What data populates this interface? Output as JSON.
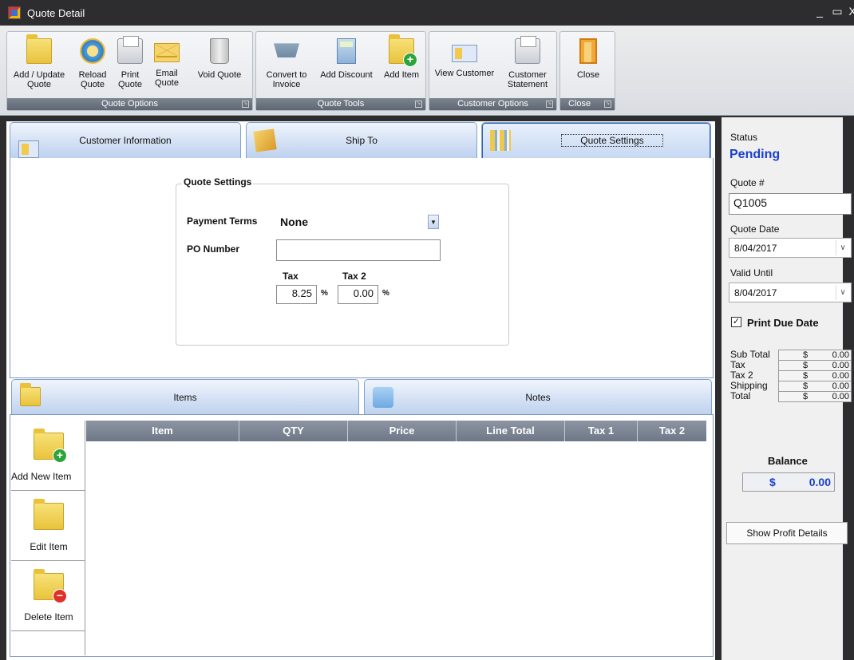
{
  "window": {
    "title": "Quote Detail",
    "minimize": "_",
    "maximize": "▭",
    "close": "X"
  },
  "ribbon": {
    "groups": [
      {
        "label": "Quote Options",
        "buttons": [
          "Add / Update\nQuote",
          "Reload\nQuote",
          "Print\nQuote",
          "Email\nQuote",
          "Void Quote"
        ]
      },
      {
        "label": "Quote Tools",
        "buttons": [
          "Convert to\nInvoice",
          "Add Discount",
          "Add Item"
        ]
      },
      {
        "label": "Customer Options",
        "buttons": [
          "View Customer",
          "Customer\nStatement"
        ]
      },
      {
        "label": "Close",
        "buttons": [
          "Close"
        ]
      }
    ]
  },
  "tabs_top": [
    "Customer Information",
    "Ship To",
    "Quote Settings"
  ],
  "quote_settings": {
    "legend": "Quote Settings",
    "payment_terms_label": "Payment Terms",
    "payment_terms_value": "None",
    "po_number_label": "PO Number",
    "po_number_value": "",
    "tax_label": "Tax",
    "tax_value": "8.25",
    "tax2_label": "Tax 2",
    "tax2_value": "0.00",
    "percent": "%"
  },
  "tabs_bottom": [
    "Items",
    "Notes"
  ],
  "items": {
    "side_buttons": [
      "Add New Item",
      "Edit Item",
      "Delete Item"
    ],
    "columns": [
      "Item",
      "QTY",
      "Price",
      "Line Total",
      "Tax 1",
      "Tax 2"
    ],
    "rows": []
  },
  "sidebar": {
    "status_label": "Status",
    "status_value": "Pending",
    "quote_no_label": "Quote #",
    "quote_no_value": "Q1005",
    "quote_date_label": "Quote Date",
    "quote_date_value": "8/04/2017",
    "valid_until_label": "Valid Until",
    "valid_until_value": "8/04/2017",
    "print_due_date_label": "Print Due Date",
    "print_due_date_checked": true,
    "totals": [
      {
        "label": "Sub Total",
        "currency": "$",
        "value": "0.00"
      },
      {
        "label": "Tax",
        "currency": "$",
        "value": "0.00"
      },
      {
        "label": "Tax 2",
        "currency": "$",
        "value": "0.00"
      },
      {
        "label": "Shipping",
        "currency": "$",
        "value": "0.00"
      },
      {
        "label": "Total",
        "currency": "$",
        "value": "0.00"
      }
    ],
    "balance_label": "Balance",
    "balance_currency": "$",
    "balance_value": "0.00",
    "profit_button": "Show Profit Details"
  },
  "colors": {
    "status_blue": "#1a3fcf",
    "tab_blue": "#bcd0ee",
    "title_bar": "#2d2d30"
  }
}
